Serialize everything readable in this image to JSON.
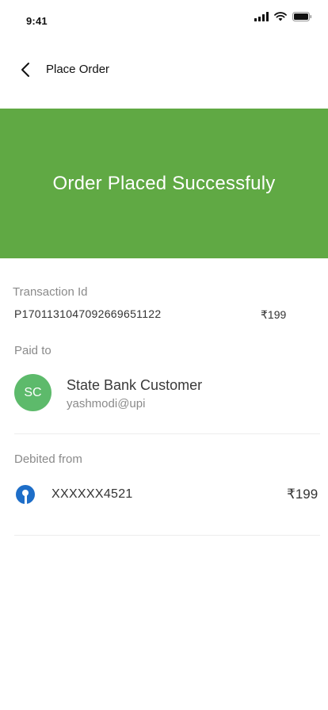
{
  "status_bar": {
    "time": "9:41"
  },
  "header": {
    "title": "Place Order"
  },
  "banner": {
    "message": "Order Placed Successfuly",
    "color": "#60a944"
  },
  "transaction": {
    "label": "Transaction Id",
    "id": "P170113104709266965112​2",
    "amount": "₹199"
  },
  "paid_to": {
    "label": "Paid to",
    "avatar_initials": "SC",
    "name": "State Bank Customer",
    "upi": "yashmodi@upi"
  },
  "debited_from": {
    "label": "Debited from",
    "account": "XXXXXX4521",
    "amount": "₹199",
    "bank_icon": "sbi-logo-icon"
  },
  "icons": [
    "chevron-left-icon",
    "signal-icon",
    "wifi-icon",
    "battery-icon",
    "sbi-logo-icon"
  ]
}
